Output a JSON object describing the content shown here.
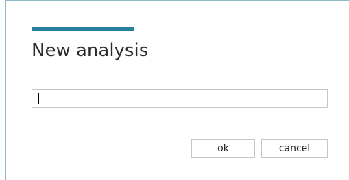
{
  "dialog": {
    "title": "New analysis",
    "accent_color": "#2a7fa0",
    "name_input": {
      "value": "",
      "placeholder": ""
    },
    "buttons": {
      "ok_label": "ok",
      "cancel_label": "cancel"
    }
  }
}
